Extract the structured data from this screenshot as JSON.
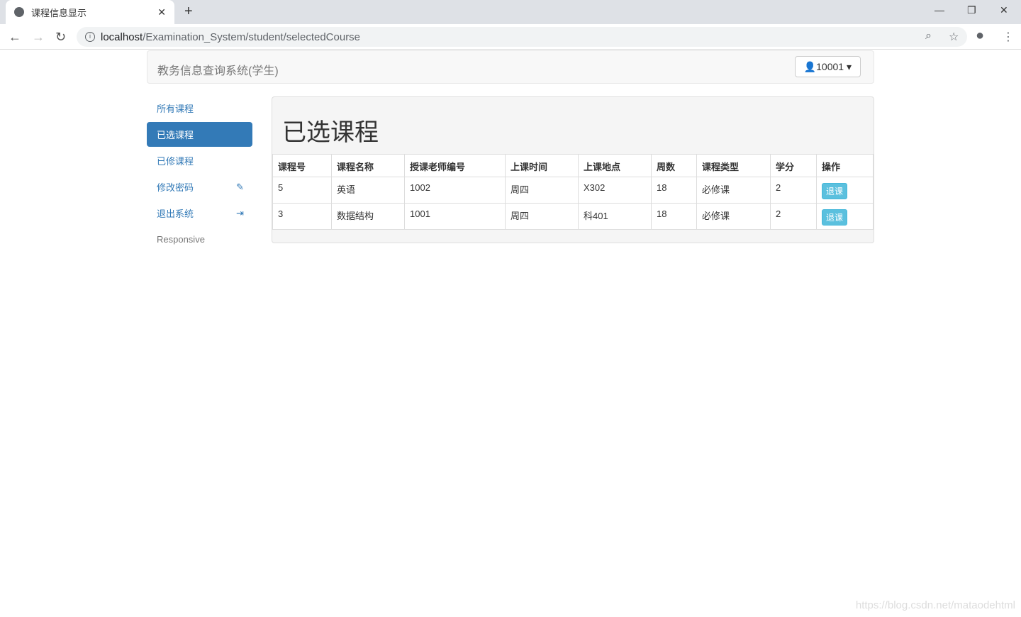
{
  "browser": {
    "tab_title": "课程信息显示",
    "url_host": "localhost",
    "url_path": "/Examination_System/student/selectedCourse"
  },
  "navbar": {
    "brand": "教务信息查询系统(学生)",
    "user": "10001"
  },
  "sidebar": {
    "items": [
      {
        "label": "所有课程"
      },
      {
        "label": "已选课程"
      },
      {
        "label": "已修课程"
      },
      {
        "label": "修改密码"
      },
      {
        "label": "退出系统"
      },
      {
        "label": "Responsive"
      }
    ]
  },
  "main": {
    "title": "已选课程",
    "columns": [
      "课程号",
      "课程名称",
      "授课老师编号",
      "上课时间",
      "上课地点",
      "周数",
      "课程类型",
      "学分",
      "操作"
    ],
    "rows": [
      [
        "5",
        "英语",
        "1002",
        "周四",
        "X302",
        "18",
        "必修课",
        "2",
        "退课"
      ],
      [
        "3",
        "数据结构",
        "1001",
        "周四",
        "科401",
        "18",
        "必修课",
        "2",
        "退课"
      ]
    ]
  },
  "watermark": "https://blog.csdn.net/mataodehtml"
}
